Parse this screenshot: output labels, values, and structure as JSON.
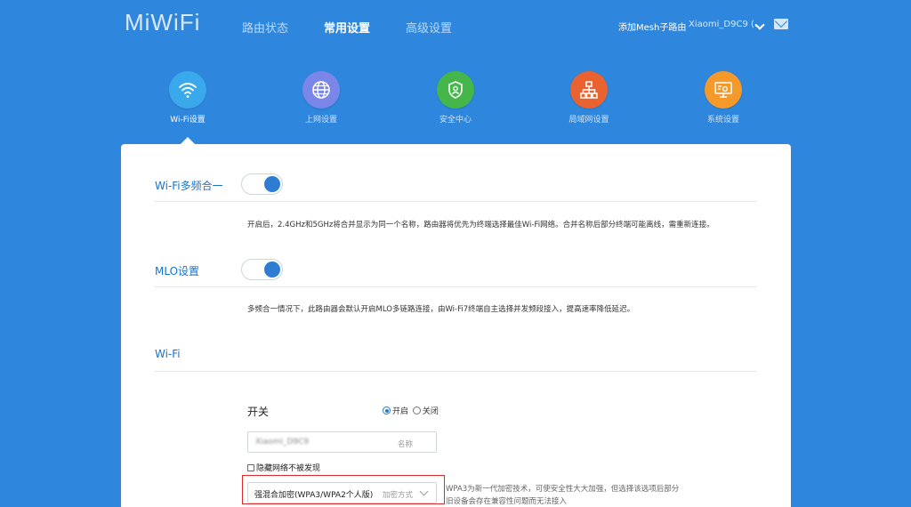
{
  "header": {
    "logo": "MiWiFi",
    "nav": [
      "路由状态",
      "常用设置",
      "高级设置"
    ],
    "active_nav": "常用设置",
    "add_mesh": "添加Mesh子路由",
    "router_name": "Xiaomi_D9C9 (..."
  },
  "categories": [
    {
      "label": "Wi-Fi设置",
      "icon": "wifi-icon",
      "color": "#3aa9ec",
      "selected": true
    },
    {
      "label": "上网设置",
      "icon": "globe-icon",
      "color": "#7a86e8",
      "selected": false
    },
    {
      "label": "安全中心",
      "icon": "shield-icon",
      "color": "#44b64a",
      "selected": false
    },
    {
      "label": "局域网设置",
      "icon": "network-icon",
      "color": "#e9622f",
      "selected": false
    },
    {
      "label": "系统设置",
      "icon": "settings-monitor-icon",
      "color": "#f5992b",
      "selected": false
    }
  ],
  "sections": {
    "multi_band": {
      "title": "Wi-Fi多频合一",
      "enabled": true,
      "desc": "开启后，2.4GHz和5GHz将合并显示为同一个名称，路由器将优先为终端选择最佳Wi-Fi网络。合并名称后部分终端可能离线，需重新连接。"
    },
    "mlo": {
      "title": "MLO设置",
      "enabled": true,
      "desc": "多频合一情况下，此路由器会默认开启MLO多链路连接，由Wi-Fi7终端自主选择并发频段接入，提高速率降低延迟。"
    },
    "wifi": {
      "title": "Wi-Fi",
      "switch_label": "开关",
      "on_label": "开启",
      "off_label": "关闭",
      "ssid_value": "Xiaomi_D9C9",
      "ssid_placeholder": "名称",
      "hide_label": "隐藏网络不被发现",
      "encryption_value": "强混合加密(WPA3/WPA2个人版)",
      "encryption_placeholder": "加密方式",
      "encryption_note": "WPA3为新一代加密技术，可使安全性大大加强，但选择该选项后部分旧设备会存在兼容性问题而无法接入"
    }
  }
}
